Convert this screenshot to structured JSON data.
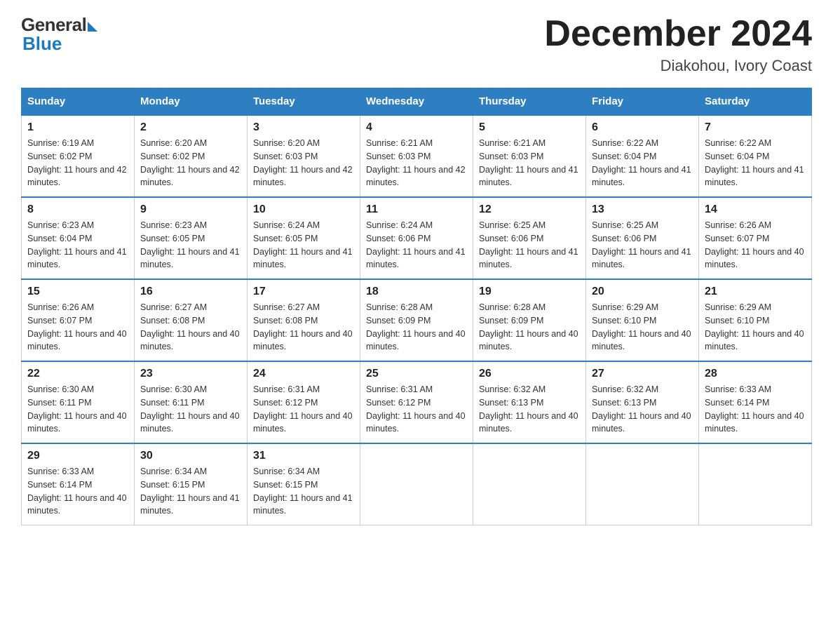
{
  "logo": {
    "general": "General",
    "blue": "Blue"
  },
  "title": "December 2024",
  "location": "Diakohou, Ivory Coast",
  "days_of_week": [
    "Sunday",
    "Monday",
    "Tuesday",
    "Wednesday",
    "Thursday",
    "Friday",
    "Saturday"
  ],
  "weeks": [
    [
      {
        "day": "1",
        "sunrise": "6:19 AM",
        "sunset": "6:02 PM",
        "daylight": "11 hours and 42 minutes."
      },
      {
        "day": "2",
        "sunrise": "6:20 AM",
        "sunset": "6:02 PM",
        "daylight": "11 hours and 42 minutes."
      },
      {
        "day": "3",
        "sunrise": "6:20 AM",
        "sunset": "6:03 PM",
        "daylight": "11 hours and 42 minutes."
      },
      {
        "day": "4",
        "sunrise": "6:21 AM",
        "sunset": "6:03 PM",
        "daylight": "11 hours and 42 minutes."
      },
      {
        "day": "5",
        "sunrise": "6:21 AM",
        "sunset": "6:03 PM",
        "daylight": "11 hours and 41 minutes."
      },
      {
        "day": "6",
        "sunrise": "6:22 AM",
        "sunset": "6:04 PM",
        "daylight": "11 hours and 41 minutes."
      },
      {
        "day": "7",
        "sunrise": "6:22 AM",
        "sunset": "6:04 PM",
        "daylight": "11 hours and 41 minutes."
      }
    ],
    [
      {
        "day": "8",
        "sunrise": "6:23 AM",
        "sunset": "6:04 PM",
        "daylight": "11 hours and 41 minutes."
      },
      {
        "day": "9",
        "sunrise": "6:23 AM",
        "sunset": "6:05 PM",
        "daylight": "11 hours and 41 minutes."
      },
      {
        "day": "10",
        "sunrise": "6:24 AM",
        "sunset": "6:05 PM",
        "daylight": "11 hours and 41 minutes."
      },
      {
        "day": "11",
        "sunrise": "6:24 AM",
        "sunset": "6:06 PM",
        "daylight": "11 hours and 41 minutes."
      },
      {
        "day": "12",
        "sunrise": "6:25 AM",
        "sunset": "6:06 PM",
        "daylight": "11 hours and 41 minutes."
      },
      {
        "day": "13",
        "sunrise": "6:25 AM",
        "sunset": "6:06 PM",
        "daylight": "11 hours and 41 minutes."
      },
      {
        "day": "14",
        "sunrise": "6:26 AM",
        "sunset": "6:07 PM",
        "daylight": "11 hours and 40 minutes."
      }
    ],
    [
      {
        "day": "15",
        "sunrise": "6:26 AM",
        "sunset": "6:07 PM",
        "daylight": "11 hours and 40 minutes."
      },
      {
        "day": "16",
        "sunrise": "6:27 AM",
        "sunset": "6:08 PM",
        "daylight": "11 hours and 40 minutes."
      },
      {
        "day": "17",
        "sunrise": "6:27 AM",
        "sunset": "6:08 PM",
        "daylight": "11 hours and 40 minutes."
      },
      {
        "day": "18",
        "sunrise": "6:28 AM",
        "sunset": "6:09 PM",
        "daylight": "11 hours and 40 minutes."
      },
      {
        "day": "19",
        "sunrise": "6:28 AM",
        "sunset": "6:09 PM",
        "daylight": "11 hours and 40 minutes."
      },
      {
        "day": "20",
        "sunrise": "6:29 AM",
        "sunset": "6:10 PM",
        "daylight": "11 hours and 40 minutes."
      },
      {
        "day": "21",
        "sunrise": "6:29 AM",
        "sunset": "6:10 PM",
        "daylight": "11 hours and 40 minutes."
      }
    ],
    [
      {
        "day": "22",
        "sunrise": "6:30 AM",
        "sunset": "6:11 PM",
        "daylight": "11 hours and 40 minutes."
      },
      {
        "day": "23",
        "sunrise": "6:30 AM",
        "sunset": "6:11 PM",
        "daylight": "11 hours and 40 minutes."
      },
      {
        "day": "24",
        "sunrise": "6:31 AM",
        "sunset": "6:12 PM",
        "daylight": "11 hours and 40 minutes."
      },
      {
        "day": "25",
        "sunrise": "6:31 AM",
        "sunset": "6:12 PM",
        "daylight": "11 hours and 40 minutes."
      },
      {
        "day": "26",
        "sunrise": "6:32 AM",
        "sunset": "6:13 PM",
        "daylight": "11 hours and 40 minutes."
      },
      {
        "day": "27",
        "sunrise": "6:32 AM",
        "sunset": "6:13 PM",
        "daylight": "11 hours and 40 minutes."
      },
      {
        "day": "28",
        "sunrise": "6:33 AM",
        "sunset": "6:14 PM",
        "daylight": "11 hours and 40 minutes."
      }
    ],
    [
      {
        "day": "29",
        "sunrise": "6:33 AM",
        "sunset": "6:14 PM",
        "daylight": "11 hours and 40 minutes."
      },
      {
        "day": "30",
        "sunrise": "6:34 AM",
        "sunset": "6:15 PM",
        "daylight": "11 hours and 41 minutes."
      },
      {
        "day": "31",
        "sunrise": "6:34 AM",
        "sunset": "6:15 PM",
        "daylight": "11 hours and 41 minutes."
      },
      null,
      null,
      null,
      null
    ]
  ]
}
